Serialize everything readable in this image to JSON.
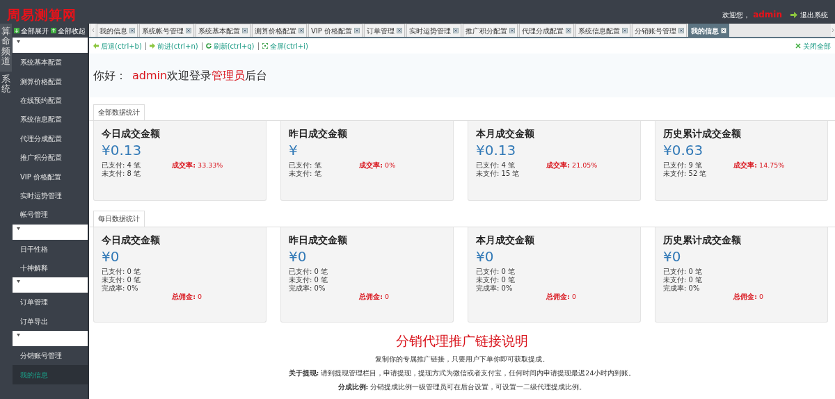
{
  "header": {
    "logo": "周易测算网",
    "welcome": "欢迎您，",
    "user": "admin",
    "logout": "退出系统"
  },
  "channels": [
    {
      "label": "算命频道",
      "selected": true
    },
    {
      "label": "系统",
      "selected": false
    }
  ],
  "sidebar": {
    "toolbar": [
      "全部展开",
      "全部收起"
    ],
    "groups": [
      {
        "expanded": true,
        "items": [
          {
            "label": "系统基本配置",
            "selected": false
          },
          {
            "label": "测算价格配置",
            "selected": false
          },
          {
            "label": "在线预约配置",
            "selected": false
          },
          {
            "label": "系统信息配置",
            "selected": false
          },
          {
            "label": "代理分成配置",
            "selected": false
          },
          {
            "label": "推广积分配置",
            "selected": false
          },
          {
            "label": "VIP 价格配置",
            "selected": false
          },
          {
            "label": "实时运势管理",
            "selected": false
          },
          {
            "label": "帐号管理",
            "selected": false
          }
        ]
      },
      {
        "expanded": true,
        "items": [
          {
            "label": "日干性格",
            "selected": false
          },
          {
            "label": "十神解释",
            "selected": false
          }
        ]
      },
      {
        "expanded": true,
        "items": [
          {
            "label": "订单管理",
            "selected": false
          },
          {
            "label": "订单导出",
            "selected": false
          }
        ]
      },
      {
        "expanded": true,
        "items": [
          {
            "label": "分销账号管理",
            "selected": false
          },
          {
            "label": "我的信息",
            "selected": true
          }
        ]
      }
    ]
  },
  "tabs": [
    {
      "label": "我的信息",
      "selected": false
    },
    {
      "label": "系统帐号管理",
      "selected": false
    },
    {
      "label": "系统基本配置",
      "selected": false
    },
    {
      "label": "测算价格配置",
      "selected": false
    },
    {
      "label": "VIP 价格配置",
      "selected": false
    },
    {
      "label": "订单管理",
      "selected": false
    },
    {
      "label": "实时运势管理",
      "selected": false
    },
    {
      "label": "推广积分配置",
      "selected": false
    },
    {
      "label": "代理分成配置",
      "selected": false
    },
    {
      "label": "系统信息配置",
      "selected": false
    },
    {
      "label": "分销账号管理",
      "selected": false
    },
    {
      "label": "我的信息",
      "selected": true
    }
  ],
  "toolbar": [
    {
      "kind": "back",
      "label": "后退(ctrl+b)"
    },
    {
      "kind": "forward",
      "label": "前进(ctrl+n)"
    },
    {
      "kind": "refresh",
      "label": "刷新(ctrl+q)"
    },
    {
      "kind": "fullscreen",
      "label": "全屏(ctrl+i)"
    }
  ],
  "close_all": "关闭全部",
  "greeting": {
    "prefix": "你好：",
    "user": "admin",
    "middle": "欢迎登录",
    "role": "管理员",
    "suffix": "后台"
  },
  "sections": [
    {
      "kind": "summary",
      "tab": "全部数据统计",
      "cards": [
        {
          "title": "今日成交金额",
          "amount": "¥0.13",
          "stats": [
            "已支付: 4 笔",
            "未支付: 8 笔"
          ],
          "rate": "**成交率:** 33.33%"
        },
        {
          "title": "昨日成交金额",
          "amount": "¥",
          "stats": [
            "已支付: 笔",
            "未支付: 笔"
          ],
          "rate": "**成交率:** 0%"
        },
        {
          "title": "本月成交金额",
          "amount": "¥0.13",
          "stats": [
            "已支付: 4 笔",
            "未支付: 15 笔"
          ],
          "rate": "**成交率:** 21.05%"
        },
        {
          "title": "历史累计成交金额",
          "amount": "¥0.63",
          "stats": [
            "已支付: 9 笔",
            "未支付: 52 笔"
          ],
          "rate": "**成交率:** 14.75%"
        }
      ]
    },
    {
      "kind": "daily",
      "tab": "每日数据统计",
      "cards": [
        {
          "title": "今日成交金额",
          "amount": "¥0",
          "stats": [
            "已支付: 0 笔",
            "未支付: 0 笔",
            "完成率: 0%"
          ],
          "rate": "**总佣金:** 0"
        },
        {
          "title": "昨日成交金额",
          "amount": "¥0",
          "stats": [
            "已支付: 0 笔",
            "未支付: 0 笔",
            "完成率: 0%"
          ],
          "rate": "**总佣金:** 0"
        },
        {
          "title": "本月成交金额",
          "amount": "¥0",
          "stats": [
            "已支付: 0 笔",
            "未支付: 0 笔",
            "完成率: 0%"
          ],
          "rate": "**总佣金:** 0"
        },
        {
          "title": "历史累计成交金额",
          "amount": "¥0",
          "stats": [
            "已支付: 0 笔",
            "未支付: 0 笔",
            "完成率: 0%"
          ],
          "rate": "**总佣金:** 0"
        }
      ]
    }
  ],
  "explanation": {
    "title": "分销代理推广链接说明",
    "paragraphs": [
      "复制你的专属推广链接，只要用户下单你即可获取提成。",
      "**关于提现:** 请到提现管理栏目，申请提现，提现方式为微信或者支付宝，任何时间内申请提现最迟24小时内到账。",
      "**分成比例:** 分销提成比例一级管理员可在后台设置，可设置一二级代理提成比例。"
    ]
  }
}
